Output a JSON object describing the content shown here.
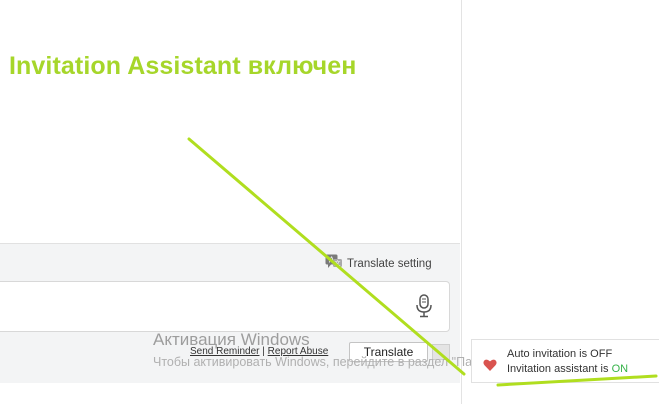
{
  "annotation": {
    "title": "Invitation Assistant включен"
  },
  "translate": {
    "setting_label": "Translate setting",
    "send_reminder": "Send Reminder",
    "separator": "|",
    "report_abuse": "Report Abuse",
    "translate_button": "Translate"
  },
  "watermark": {
    "title": "Активация Windows",
    "subtitle": "Чтобы активировать Windows, перейдите в раздел \"Параметры\"."
  },
  "status": {
    "auto_invitation_prefix": "Auto invitation is",
    "auto_invitation_value": "OFF",
    "invitation_assistant_prefix": "Invitation assistant is",
    "invitation_assistant_value": "ON"
  },
  "colors": {
    "annotation": "#a6d62a",
    "on": "#36b34a",
    "heart": "#d9534f"
  },
  "icons": [
    "translate-icon",
    "microphone-icon",
    "heart-icon"
  ]
}
